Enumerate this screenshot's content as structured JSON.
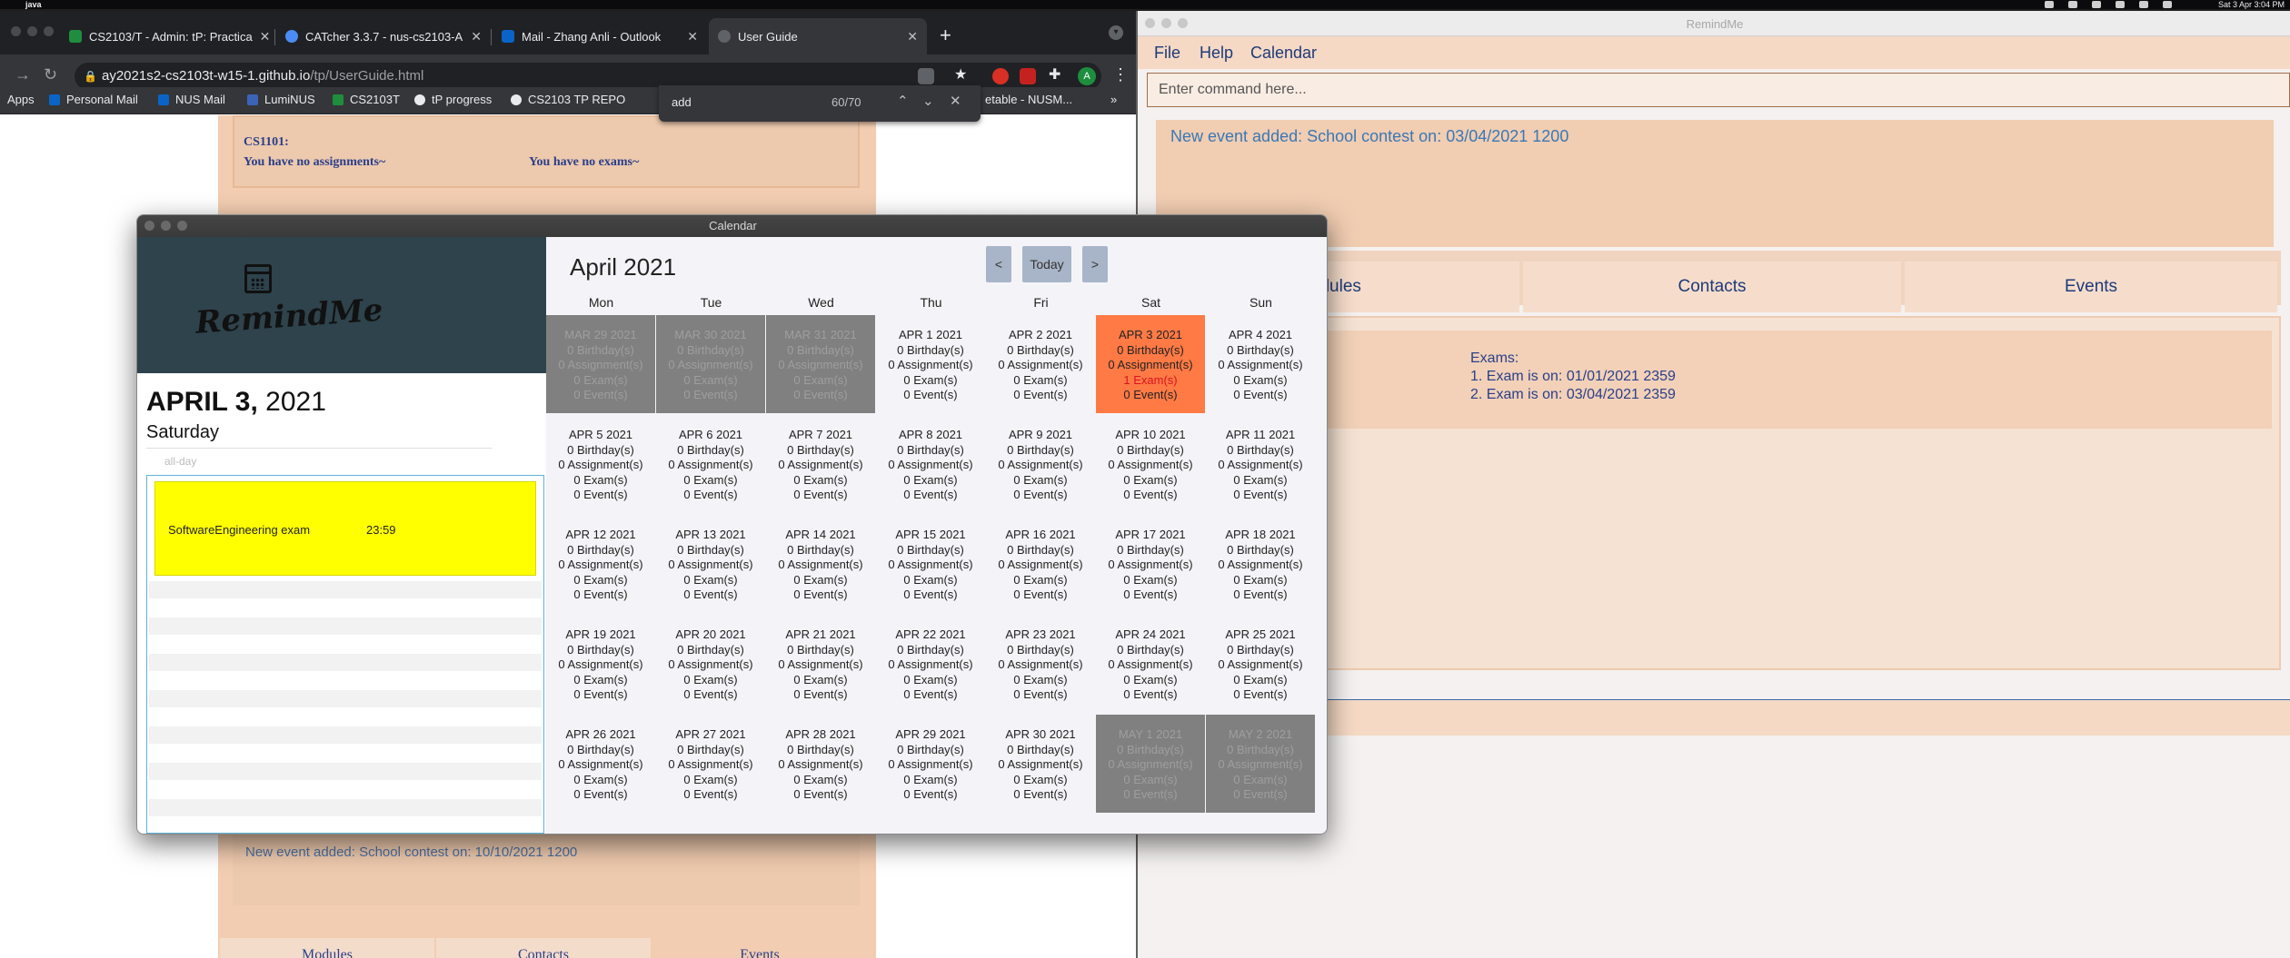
{
  "mac": {
    "app_name": "java",
    "clock": "Sat 3 Apr  3:04 PM"
  },
  "browser": {
    "tabs": [
      {
        "label": "CS2103/T - Admin: tP: Practica",
        "favicon_color": "#1e8e3e"
      },
      {
        "label": "CATcher 3.3.7 - nus-cs2103-A",
        "favicon_color": "#4c8bf5"
      },
      {
        "label": "Mail - Zhang Anli - Outlook",
        "favicon_color": "#0a64c8"
      },
      {
        "label": "User Guide",
        "favicon_color": "#5f6368"
      }
    ],
    "url_host": "ay2021s2-cs2103t-w15-1.github.io",
    "url_path": "/tp/UserGuide.html",
    "profile_initial": "A",
    "bookmarks": [
      "Apps",
      "Personal Mail",
      "NUS Mail",
      "LumiNUS",
      "CS2103T",
      "tP progress",
      "CS2103 TP REPO",
      "etable - NUSM..."
    ],
    "bookmarks_more": "»",
    "find": {
      "query": "add",
      "count": "60/70"
    }
  },
  "guide": {
    "module_code": "CS1101:",
    "no_assignments": "You have no assignments~",
    "no_exams": "You have no exams~",
    "bottom_message": "New event added: School contest on: 10/10/2021 1200",
    "tabs": [
      "Modules",
      "Contacts",
      "Events"
    ]
  },
  "remindme": {
    "title": "RemindMe",
    "menus": [
      "File",
      "Help",
      "Calendar"
    ],
    "command_placeholder": "Enter command here...",
    "result": "New event added: School contest on: 03/04/2021 1200",
    "tabs": [
      "Modules",
      "Contacts",
      "Events"
    ],
    "exams_header": "Exams:",
    "exams": [
      "1. Exam is on: 01/01/2021 2359",
      "2. Exam is on: 03/04/2021 2359"
    ]
  },
  "calendar": {
    "window_title": "Calendar",
    "logo_text": "RemindMe",
    "selected_date_bold": "APRIL 3,",
    "selected_date_year": "2021",
    "selected_day": "Saturday",
    "all_day_label": "all-day",
    "event_name": "SoftwareEngineering exam",
    "event_time": "23:59",
    "month_title": "April  2021",
    "nav": {
      "prev": "<",
      "today": "Today",
      "next": ">"
    },
    "weekdays": [
      "Mon",
      "Tue",
      "Wed",
      "Thu",
      "Fri",
      "Sat",
      "Sun"
    ],
    "cells": [
      {
        "date": "MAR 29 2021",
        "b": "0 Birthday(s)",
        "a": "0 Assignment(s)",
        "x": "0 Exam(s)",
        "e": "0 Event(s)",
        "state": "other"
      },
      {
        "date": "MAR 30 2021",
        "b": "0 Birthday(s)",
        "a": "0 Assignment(s)",
        "x": "0 Exam(s)",
        "e": "0 Event(s)",
        "state": "other"
      },
      {
        "date": "MAR 31 2021",
        "b": "0 Birthday(s)",
        "a": "0 Assignment(s)",
        "x": "0 Exam(s)",
        "e": "0 Event(s)",
        "state": "other"
      },
      {
        "date": "APR 1 2021",
        "b": "0 Birthday(s)",
        "a": "0 Assignment(s)",
        "x": "0 Exam(s)",
        "e": "0 Event(s)",
        "state": "normal"
      },
      {
        "date": "APR 2 2021",
        "b": "0 Birthday(s)",
        "a": "0 Assignment(s)",
        "x": "0 Exam(s)",
        "e": "0 Event(s)",
        "state": "normal"
      },
      {
        "date": "APR 3 2021",
        "b": "0 Birthday(s)",
        "a": "0 Assignment(s)",
        "x": "1 Exam(s)",
        "e": "0 Event(s)",
        "state": "today"
      },
      {
        "date": "APR 4 2021",
        "b": "0 Birthday(s)",
        "a": "0 Assignment(s)",
        "x": "0 Exam(s)",
        "e": "0 Event(s)",
        "state": "normal"
      },
      {
        "date": "APR 5 2021",
        "b": "0 Birthday(s)",
        "a": "0 Assignment(s)",
        "x": "0 Exam(s)",
        "e": "0 Event(s)",
        "state": "normal"
      },
      {
        "date": "APR 6 2021",
        "b": "0 Birthday(s)",
        "a": "0 Assignment(s)",
        "x": "0 Exam(s)",
        "e": "0 Event(s)",
        "state": "normal"
      },
      {
        "date": "APR 7 2021",
        "b": "0 Birthday(s)",
        "a": "0 Assignment(s)",
        "x": "0 Exam(s)",
        "e": "0 Event(s)",
        "state": "normal"
      },
      {
        "date": "APR 8 2021",
        "b": "0 Birthday(s)",
        "a": "0 Assignment(s)",
        "x": "0 Exam(s)",
        "e": "0 Event(s)",
        "state": "normal"
      },
      {
        "date": "APR 9 2021",
        "b": "0 Birthday(s)",
        "a": "0 Assignment(s)",
        "x": "0 Exam(s)",
        "e": "0 Event(s)",
        "state": "normal"
      },
      {
        "date": "APR 10 2021",
        "b": "0 Birthday(s)",
        "a": "0 Assignment(s)",
        "x": "0 Exam(s)",
        "e": "0 Event(s)",
        "state": "normal"
      },
      {
        "date": "APR 11 2021",
        "b": "0 Birthday(s)",
        "a": "0 Assignment(s)",
        "x": "0 Exam(s)",
        "e": "0 Event(s)",
        "state": "normal"
      },
      {
        "date": "APR 12 2021",
        "b": "0 Birthday(s)",
        "a": "0 Assignment(s)",
        "x": "0 Exam(s)",
        "e": "0 Event(s)",
        "state": "normal"
      },
      {
        "date": "APR 13 2021",
        "b": "0 Birthday(s)",
        "a": "0 Assignment(s)",
        "x": "0 Exam(s)",
        "e": "0 Event(s)",
        "state": "normal"
      },
      {
        "date": "APR 14 2021",
        "b": "0 Birthday(s)",
        "a": "0 Assignment(s)",
        "x": "0 Exam(s)",
        "e": "0 Event(s)",
        "state": "normal"
      },
      {
        "date": "APR 15 2021",
        "b": "0 Birthday(s)",
        "a": "0 Assignment(s)",
        "x": "0 Exam(s)",
        "e": "0 Event(s)",
        "state": "normal"
      },
      {
        "date": "APR 16 2021",
        "b": "0 Birthday(s)",
        "a": "0 Assignment(s)",
        "x": "0 Exam(s)",
        "e": "0 Event(s)",
        "state": "normal"
      },
      {
        "date": "APR 17 2021",
        "b": "0 Birthday(s)",
        "a": "0 Assignment(s)",
        "x": "0 Exam(s)",
        "e": "0 Event(s)",
        "state": "normal"
      },
      {
        "date": "APR 18 2021",
        "b": "0 Birthday(s)",
        "a": "0 Assignment(s)",
        "x": "0 Exam(s)",
        "e": "0 Event(s)",
        "state": "normal"
      },
      {
        "date": "APR 19 2021",
        "b": "0 Birthday(s)",
        "a": "0 Assignment(s)",
        "x": "0 Exam(s)",
        "e": "0 Event(s)",
        "state": "normal"
      },
      {
        "date": "APR 20 2021",
        "b": "0 Birthday(s)",
        "a": "0 Assignment(s)",
        "x": "0 Exam(s)",
        "e": "0 Event(s)",
        "state": "normal"
      },
      {
        "date": "APR 21 2021",
        "b": "0 Birthday(s)",
        "a": "0 Assignment(s)",
        "x": "0 Exam(s)",
        "e": "0 Event(s)",
        "state": "normal"
      },
      {
        "date": "APR 22 2021",
        "b": "0 Birthday(s)",
        "a": "0 Assignment(s)",
        "x": "0 Exam(s)",
        "e": "0 Event(s)",
        "state": "normal"
      },
      {
        "date": "APR 23 2021",
        "b": "0 Birthday(s)",
        "a": "0 Assignment(s)",
        "x": "0 Exam(s)",
        "e": "0 Event(s)",
        "state": "normal"
      },
      {
        "date": "APR 24 2021",
        "b": "0 Birthday(s)",
        "a": "0 Assignment(s)",
        "x": "0 Exam(s)",
        "e": "0 Event(s)",
        "state": "normal"
      },
      {
        "date": "APR 25 2021",
        "b": "0 Birthday(s)",
        "a": "0 Assignment(s)",
        "x": "0 Exam(s)",
        "e": "0 Event(s)",
        "state": "normal"
      },
      {
        "date": "APR 26 2021",
        "b": "0 Birthday(s)",
        "a": "0 Assignment(s)",
        "x": "0 Exam(s)",
        "e": "0 Event(s)",
        "state": "normal"
      },
      {
        "date": "APR 27 2021",
        "b": "0 Birthday(s)",
        "a": "0 Assignment(s)",
        "x": "0 Exam(s)",
        "e": "0 Event(s)",
        "state": "normal"
      },
      {
        "date": "APR 28 2021",
        "b": "0 Birthday(s)",
        "a": "0 Assignment(s)",
        "x": "0 Exam(s)",
        "e": "0 Event(s)",
        "state": "normal"
      },
      {
        "date": "APR 29 2021",
        "b": "0 Birthday(s)",
        "a": "0 Assignment(s)",
        "x": "0 Exam(s)",
        "e": "0 Event(s)",
        "state": "normal"
      },
      {
        "date": "APR 30 2021",
        "b": "0 Birthday(s)",
        "a": "0 Assignment(s)",
        "x": "0 Exam(s)",
        "e": "0 Event(s)",
        "state": "normal"
      },
      {
        "date": "MAY 1 2021",
        "b": "0 Birthday(s)",
        "a": "0 Assignment(s)",
        "x": "0 Exam(s)",
        "e": "0 Event(s)",
        "state": "other"
      },
      {
        "date": "MAY 2 2021",
        "b": "0 Birthday(s)",
        "a": "0 Assignment(s)",
        "x": "0 Exam(s)",
        "e": "0 Event(s)",
        "state": "other"
      }
    ]
  },
  "colors": {
    "today_cell": "#ff7a45",
    "event_block": "#ffff00",
    "other_month_cell": "#808080",
    "remindme_accent": "#f5d9c4"
  }
}
